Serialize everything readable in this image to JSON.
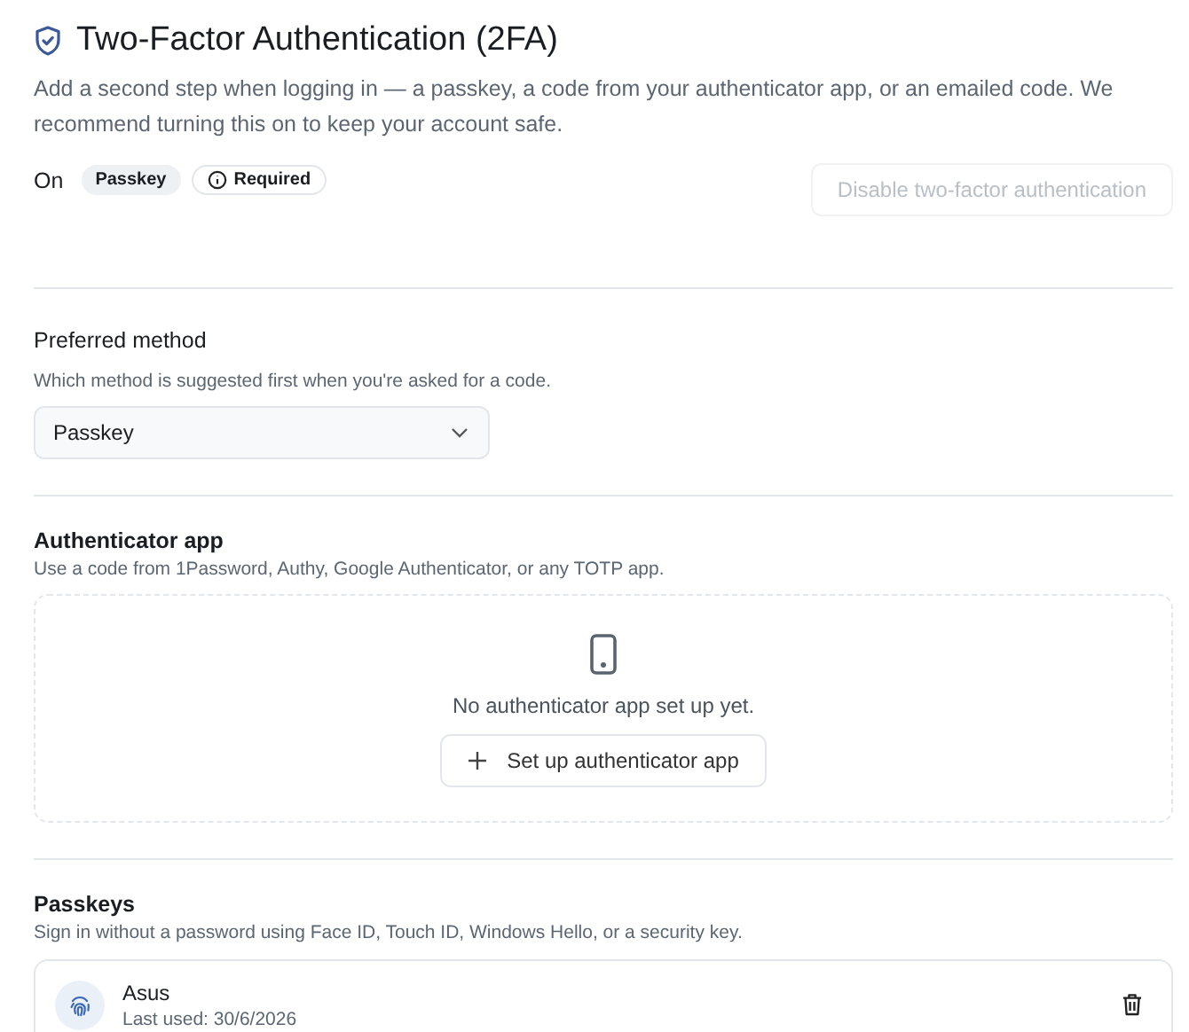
{
  "header": {
    "title": "Two-Factor Authentication (2FA)",
    "description": "Add a second step when logging in — a passkey, a code from your authenticator app, or an emailed code. We recommend turning this on to keep your account safe."
  },
  "status": {
    "label": "On",
    "badges": [
      {
        "label": "Passkey",
        "kind": "filled"
      },
      {
        "label": "Required",
        "kind": "info"
      }
    ],
    "disable_button": {
      "label": "Disable two-factor authentication",
      "disabled": true
    }
  },
  "preferred_method": {
    "title": "Preferred method",
    "description": "Which method is suggested first when you're asked for a code.",
    "value": "Passkey"
  },
  "authenticator": {
    "title": "Authenticator app",
    "description": "Use a code from 1Password, Authy, Google Authenticator, or any TOTP app.",
    "empty_text": "No authenticator app set up yet.",
    "button": "Set up authenticator app"
  },
  "passkeys": {
    "title": "Passkeys",
    "description": "Sign in without a password using Face ID, Touch ID, Windows Hello, or a security key.",
    "items": [
      {
        "name": "Asus",
        "last_used": "Last used: 30/6/2026"
      }
    ]
  }
}
